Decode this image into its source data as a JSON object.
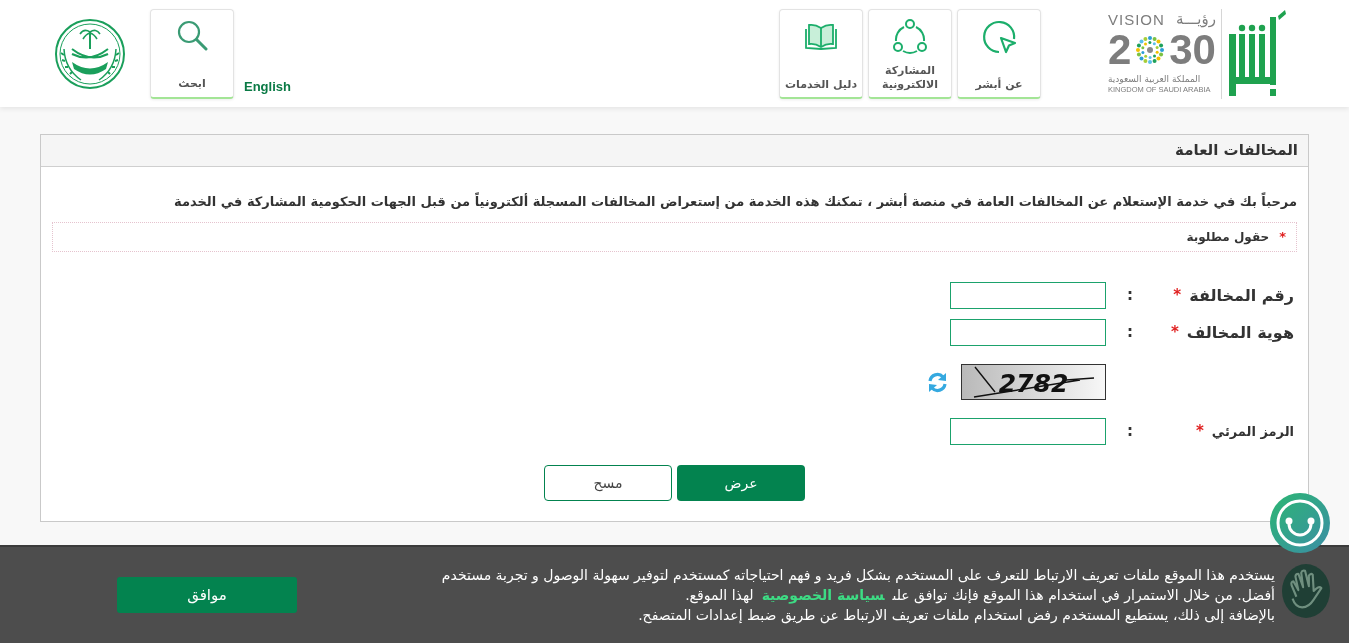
{
  "header": {
    "logo": {
      "vision": "VISION",
      "vision_ar": "رؤيـــة",
      "year_start": "2",
      "year_end": "30",
      "country_ar": "المملكة العربية السعودية",
      "country_en": "KINGDOM OF SAUDI ARABIA"
    },
    "nav": [
      {
        "label": "عن أبشر"
      },
      {
        "label": "المشاركة الالكترونية"
      },
      {
        "label": "دليل الخدمات"
      }
    ],
    "language_link": "English",
    "search": {
      "label": "ابحث"
    }
  },
  "panel": {
    "title": "المخالفات العامة",
    "intro": "مرحباً بك في خدمة الإستعلام عن المخالفات العامة في منصة أبشر ، تمكنك هذه الخدمة من إستعراض المخالفات المسجلة ألكترونياً من قبل الجهات الحكومية المشاركة في الخدمة",
    "required_note": {
      "mark": "*",
      "text": "حقول مطلوبة"
    },
    "fields": [
      {
        "label": "رقم المخالفة",
        "required_mark": "*",
        "separator": ":"
      },
      {
        "label": "هوية المخالف",
        "required_mark": "*",
        "separator": ":"
      }
    ],
    "captcha": {
      "code": "2782",
      "label": "الرمز المرئي",
      "required_mark": "*",
      "separator": ":"
    },
    "buttons": [
      {
        "label": "عرض",
        "kind": "primary"
      },
      {
        "label": "مسح",
        "kind": "secondary"
      }
    ]
  },
  "cookie_banner": {
    "text_before_link": "يستخدم هذا الموقع ملفات تعريف الارتباط للتعرف على المستخدم بشكل فريد و فهم احتياجاته كمستخدم لتوفير سهولة الوصول و تجربة مستخدم أفضل. من خلال الاستمرار في استخدام هذا الموقع فإنك توافق على",
    "link": "سياسة الخصوصية",
    "text_after_link": "لهذا الموقع.",
    "second_line": "بالإضافة إلى ذلك، يستطيع المستخدم رفض استخدام ملفات تعريف الارتباط عن طريق ضبط إعدادات المتصفح.",
    "accept": "موافق"
  }
}
